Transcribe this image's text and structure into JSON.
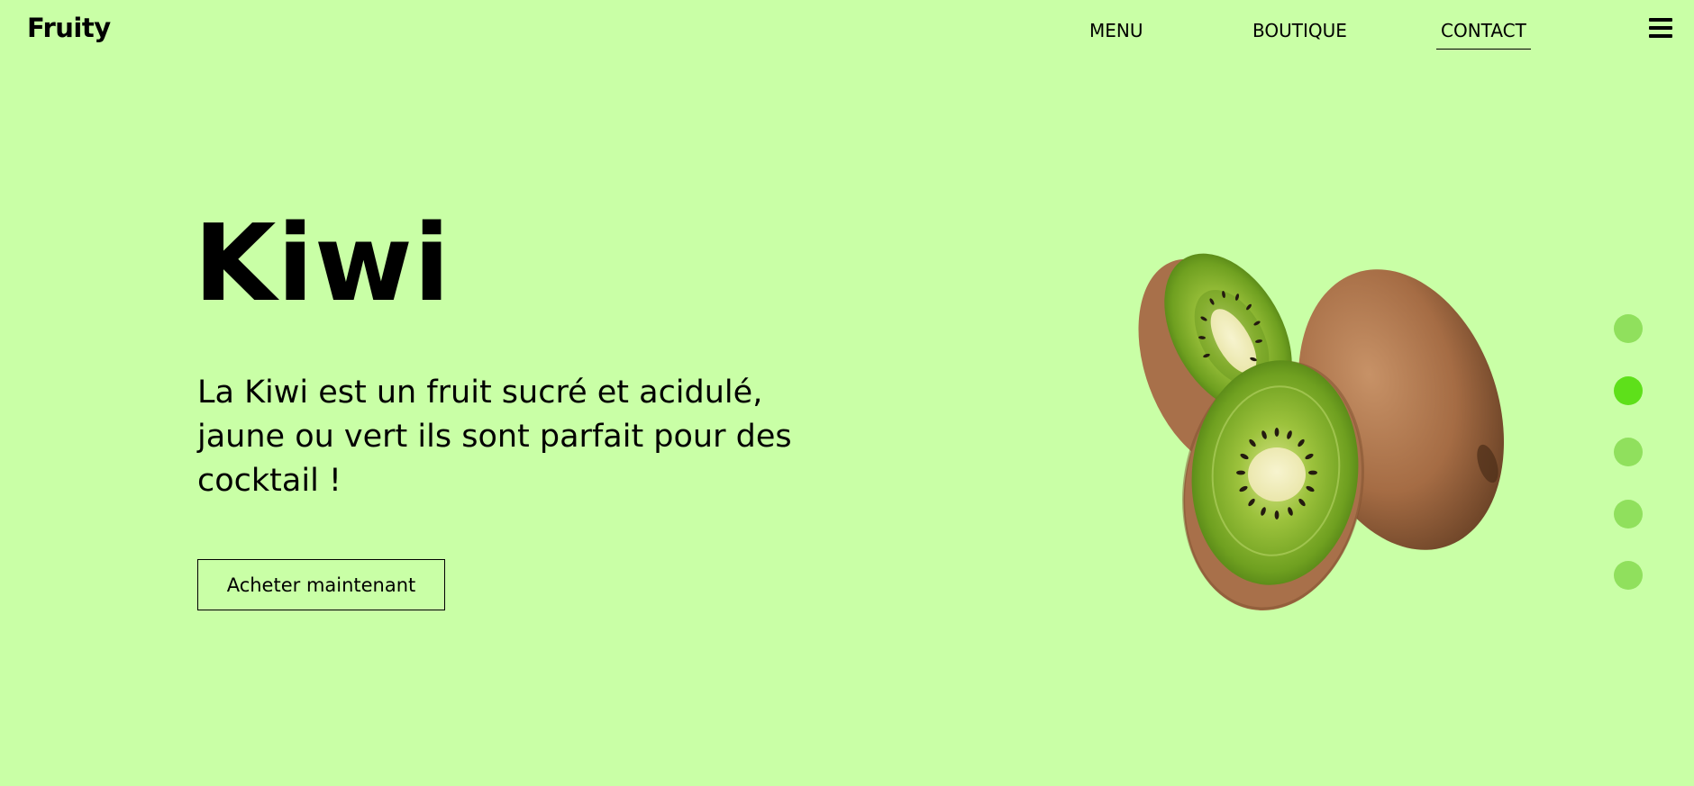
{
  "brand": "Fruity",
  "nav": {
    "items": [
      {
        "label": "MENU"
      },
      {
        "label": "BOUTIQUE"
      },
      {
        "label": "CONTACT",
        "active": true
      }
    ],
    "menu_icon": "hamburger-menu-icon"
  },
  "hero": {
    "title": "Kiwi",
    "description": "La Kiwi est un fruit sucré et acidulé, jaune ou vert ils sont parfait pour des cocktail !",
    "cta_label": "Acheter maintenant",
    "image": "kiwi-fruit-image"
  },
  "slider": {
    "count": 5,
    "active_index": 1
  },
  "colors": {
    "background": "#c9ffa6",
    "dot": "#90e05d",
    "dot_active": "#5ee01a",
    "text": "#000000"
  }
}
